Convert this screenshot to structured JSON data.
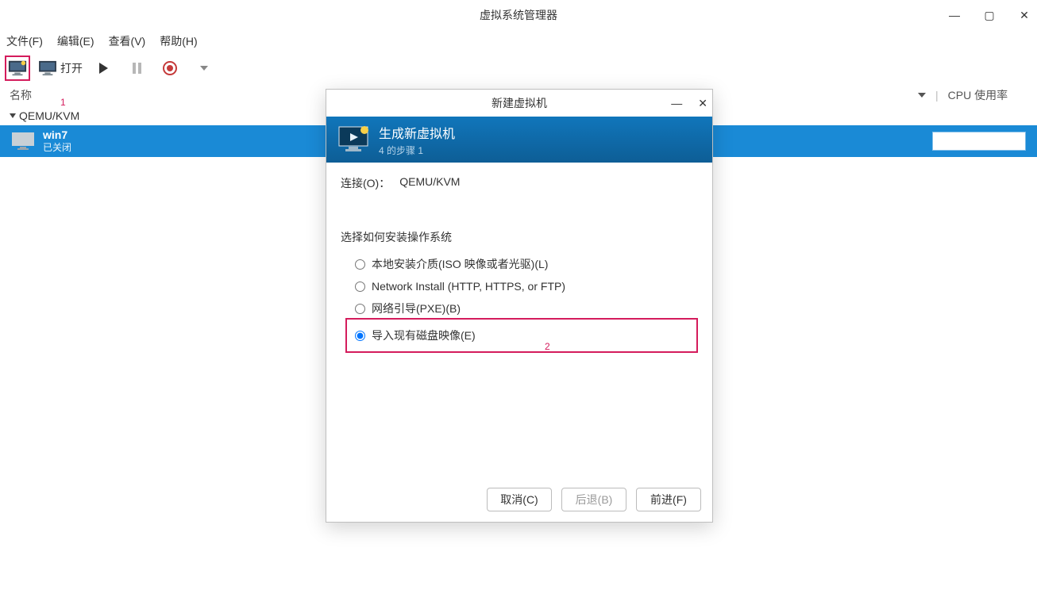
{
  "window": {
    "title": "虚拟系统管理器"
  },
  "menubar": {
    "file": "文件(F)",
    "edit": "编辑(E)",
    "view": "查看(V)",
    "help": "帮助(H)"
  },
  "toolbar": {
    "open_label": "打开"
  },
  "list_header": {
    "name_col": "名称",
    "cpu_col": "CPU 使用率"
  },
  "tree": {
    "root": "QEMU/KVM",
    "vm": {
      "name": "win7",
      "state": "已关闭"
    }
  },
  "annotations": {
    "a1": "1",
    "a2": "2"
  },
  "dialog": {
    "title": "新建虚拟机",
    "banner_title": "生成新虚拟机",
    "banner_step": "4 的步骤 1",
    "connection_label": "连接(O)：",
    "connection_value": "QEMU/KVM",
    "choose_label": "选择如何安装操作系统",
    "options": {
      "local": "本地安装介质(ISO 映像或者光驱)(L)",
      "network": "Network Install (HTTP, HTTPS, or FTP)",
      "pxe": "网络引导(PXE)(B)",
      "import": "导入现有磁盘映像(E)"
    },
    "buttons": {
      "cancel": "取消(C)",
      "back": "后退(B)",
      "forward": "前进(F)"
    }
  }
}
